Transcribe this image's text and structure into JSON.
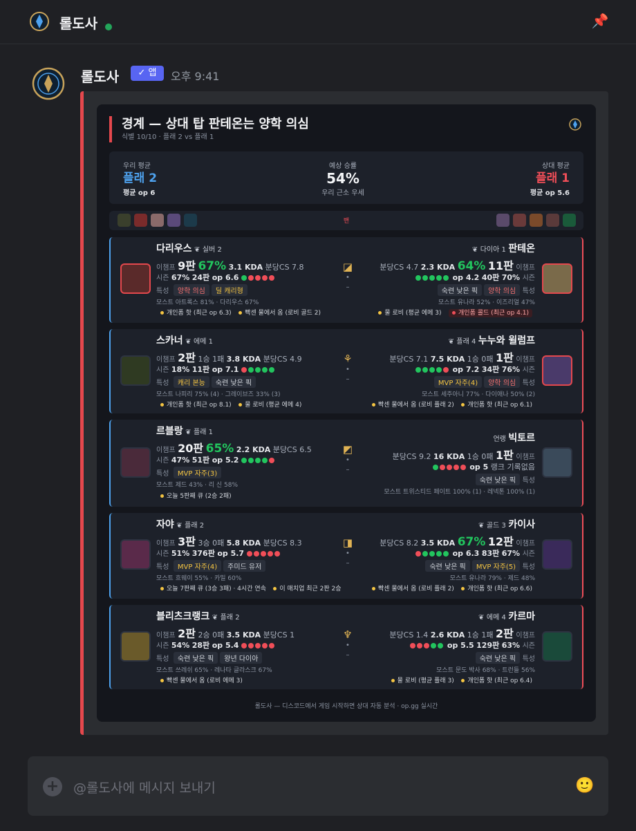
{
  "header": {
    "title": "롤도사",
    "pin_icon": "pin-icon"
  },
  "message": {
    "author": "롤도사",
    "app_badge": "앱",
    "app_check": "✓",
    "timestamp": "오후 9:41"
  },
  "card": {
    "title": "경계 — 상대 탑 판테온는 양학 의심",
    "subtitle": "식별 10/10 · 플래 2 vs 플래 1",
    "summary": {
      "our_label": "우리 평균",
      "our_rank": "플래 2",
      "our_op": "평균 op 6",
      "win_label": "예상 승률",
      "win_value": "54%",
      "win_note": "우리 근소 우세",
      "their_label": "상대 평균",
      "their_rank": "플래 1",
      "their_op": "평균 op 5.6"
    },
    "picks_center": "밴",
    "matchups": [
      {
        "left": {
          "name": "다리우스",
          "tier": "실버 2",
          "lbl_champ": "이챔프",
          "games": "9판",
          "wr": "67%",
          "kda": "3.1 KDA",
          "cs": "분당CS 7.8",
          "lbl_season": "시즌",
          "season_wr": "67%",
          "season_games": "24판",
          "op": "op 6.6",
          "lbl_trait": "특성",
          "tag1": "양학 의심",
          "tag2": "딜 캐리형",
          "most": "모스트 아트록스 81% · 다리우스 67%",
          "note1": "개인폼 핫 (최근 op 6.3)",
          "note2": "빡센 물에서 옴 (로비 골드 2)"
        },
        "right": {
          "name": "판테온",
          "tier": "다이아 1",
          "lbl_champ": "이챔프",
          "games": "11판",
          "wr": "64%",
          "kda": "2.3 KDA",
          "cs": "분당CS 4.7",
          "lbl_season": "시즌",
          "season_wr": "70%",
          "season_games": "40판",
          "op": "op 4.2",
          "lbl_trait": "특성",
          "tag1": "숙련 낮은 픽",
          "tag2": "양학 의심",
          "most": "모스트 유나라 52% · 이즈리얼 47%",
          "note1": "물 로비 (평균 에메 3)",
          "note2": "개인폼 콜드 (최근 op 4.1)"
        }
      },
      {
        "left": {
          "name": "스카너",
          "tier": "에메 1",
          "lbl_champ": "이챔프",
          "games": "2판",
          "record": "1승 1패",
          "kda": "3.8 KDA",
          "cs": "분당CS 4.9",
          "lbl_season": "시즌",
          "season_wr": "18%",
          "season_games": "11판",
          "op": "op 7.1",
          "lbl_trait": "특성",
          "tag1": "캐리 본능",
          "tag2": "숙련 낮은 픽",
          "most": "모스트 나피리 75% (4) · 그레이브즈 33% (3)",
          "note1": "개인폼 핫 (최근 op 8.1)",
          "note2": "물 로비 (평균 에메 4)"
        },
        "right": {
          "name": "누누와 윌럼프",
          "tier": "플래 4",
          "lbl_champ": "이챔프",
          "games": "1판",
          "record": "1승 0패",
          "kda": "7.5 KDA",
          "cs": "분당CS 7.1",
          "lbl_season": "시즌",
          "season_wr": "76%",
          "season_games": "34판",
          "op": "op 7.2",
          "lbl_trait": "특성",
          "tag1": "MVP 자주(4)",
          "tag2": "양학 의심",
          "most": "모스트 세주아니 77% · 다이애나 50% (2)",
          "note1": "빡센 물에서 옴 (로비 플래 2)",
          "note2": "개인폼 핫 (최근 op 6.1)"
        }
      },
      {
        "left": {
          "name": "르블랑",
          "tier": "플래 1",
          "lbl_champ": "이챔프",
          "games": "20판",
          "wr": "65%",
          "kda": "2.2 KDA",
          "cs": "분당CS 6.5",
          "lbl_season": "시즌",
          "season_wr": "47%",
          "season_games": "51판",
          "op": "op 5.2",
          "lbl_trait": "특성",
          "tag1": "MVP 자주(3)",
          "most": "모스트 제드 43% · 리 신 58%",
          "note1": "오늘 5판째 큐 (2승 2패)"
        },
        "right": {
          "name": "빅토르",
          "tier": "언랭",
          "lbl_champ": "이챔프",
          "games": "1판",
          "record": "1승 0패",
          "kda": "16 KDA",
          "cs": "분당CS 9.2",
          "op": "op 5",
          "rank_note": "랭크 기록없음",
          "lbl_trait": "특성",
          "tag1": "숙련 낮은 픽",
          "most": "모스트 트위스티드 페이트 100% (1) · 레넥톤 100% (1)"
        }
      },
      {
        "left": {
          "name": "자야",
          "tier": "플래 2",
          "lbl_champ": "이챔프",
          "games": "3판",
          "record": "3승 0패",
          "kda": "5.8 KDA",
          "cs": "분당CS 8.3",
          "lbl_season": "시즌",
          "season_wr": "51%",
          "season_games": "376판",
          "op": "op 5.7",
          "lbl_trait": "특성",
          "tag1": "MVP 자주(4)",
          "tag2": "주미드 유저",
          "most": "모스트 흐웨이 55% · 카밀 60%",
          "note1": "오늘 7판째 큐 (3승 3패) · 4시간 연속",
          "note2": "이 매치업 최근 2판 2승"
        },
        "right": {
          "name": "카이사",
          "tier": "골드 3",
          "lbl_champ": "이챔프",
          "games": "12판",
          "wr": "67%",
          "kda": "3.5 KDA",
          "cs": "분당CS 8.2",
          "lbl_season": "시즌",
          "season_wr": "67%",
          "season_games": "83판",
          "op": "op 6.3",
          "lbl_trait": "특성",
          "tag1": "숙련 낮은 픽",
          "tag2": "MVP 자주(5)",
          "most": "모스트 유나라 79% · 제드 48%",
          "note1": "빡센 물에서 옴 (로비 플래 2)",
          "note2": "개인폼 핫 (최근 op 6.6)"
        }
      },
      {
        "left": {
          "name": "블리츠크랭크",
          "tier": "플래 2",
          "lbl_champ": "이챔프",
          "games": "2판",
          "record": "2승 0패",
          "kda": "3.5 KDA",
          "cs": "분당CS 1",
          "lbl_season": "시즌",
          "season_wr": "54%",
          "season_games": "28판",
          "op": "op 5.4",
          "lbl_trait": "특성",
          "tag1": "숙련 낮은 픽",
          "tag2": "왕년 다이아",
          "most": "모스트 쓰레쉬 65% · 레나타 글라스크 67%",
          "note1": "빡센 물에서 옴 (로비 에메 3)"
        },
        "right": {
          "name": "카르마",
          "tier": "에메 4",
          "lbl_champ": "이챔프",
          "games": "2판",
          "record": "1승 1패",
          "kda": "2.6 KDA",
          "cs": "분당CS 1.4",
          "lbl_season": "시즌",
          "season_wr": "63%",
          "season_games": "129판",
          "op": "op 5.5",
          "lbl_trait": "특성",
          "tag1": "숙련 낮은 픽",
          "most": "모스트 문도 박사 68% · 트런들 56%",
          "note1": "물 로비 (평균 플래 3)",
          "note2": "개인폼 핫 (최근 op 6.4)"
        }
      }
    ],
    "footer": "롤도사 — 디스코드에서 게임 시작하면 상대 자동 분석 · op.gg 실시간"
  },
  "composer": {
    "placeholder": "@롤도사에 메시지 보내기",
    "plus": "+",
    "emoji": "🙂"
  },
  "colors": {
    "accent": "#e5484d",
    "our_team": "#4ea2ee",
    "enemy_team": "#f04e58",
    "positive": "#22c55e",
    "app_badge": "#5865f2"
  }
}
